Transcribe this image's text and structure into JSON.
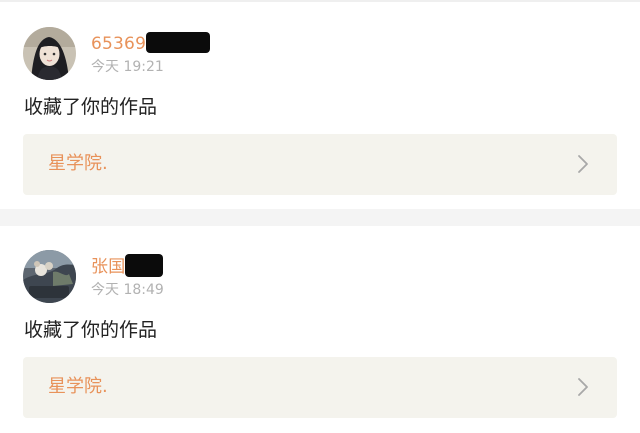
{
  "feed": [
    {
      "username": "65369",
      "time": "今天 19:21",
      "action": "收藏了你的作品",
      "work_title": "星学院.",
      "avatar_icon": "user-avatar-girl",
      "redacted": true
    },
    {
      "username": "张国",
      "time": "今天 18:49",
      "action": "收藏了你的作品",
      "work_title": "星学院.",
      "avatar_icon": "user-avatar-photo",
      "redacted": true
    }
  ],
  "colors": {
    "accent": "#e8925a",
    "muted": "#b2b2b2",
    "text": "#222222",
    "box_bg": "#f4f3ed",
    "divider": "#f4f4f4"
  }
}
